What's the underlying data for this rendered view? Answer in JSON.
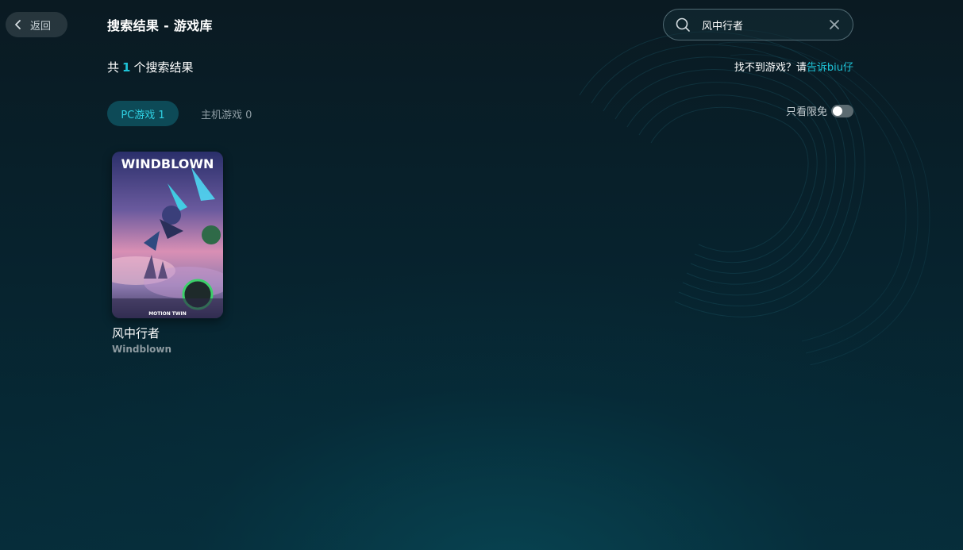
{
  "header": {
    "back_label": "返回",
    "title": "搜索结果 - 游戏库"
  },
  "search": {
    "value": "风中行者"
  },
  "results": {
    "prefix": "共",
    "count": "1",
    "suffix": "个搜索结果"
  },
  "feedback": {
    "text": "找不到游戏？请",
    "link": "告诉biu仔"
  },
  "tabs": [
    {
      "label": "PC游戏 1",
      "active": true
    },
    {
      "label": "主机游戏 0",
      "active": false
    }
  ],
  "filter": {
    "free_only_label": "只看限免",
    "free_only_enabled": false
  },
  "games": [
    {
      "name": "风中行者",
      "subtitle": "Windblown",
      "cover_logo": "WINDBLOWN",
      "cover_publisher": "MOTION TWIN"
    }
  ],
  "colors": {
    "accent": "#1ec4d8",
    "tab_active_bg": "#0d4a57",
    "background_top": "#0a1a22",
    "background_bottom": "#062d3a"
  },
  "icons": {
    "back": "chevron-left-icon",
    "search": "search-icon",
    "clear": "close-icon"
  }
}
